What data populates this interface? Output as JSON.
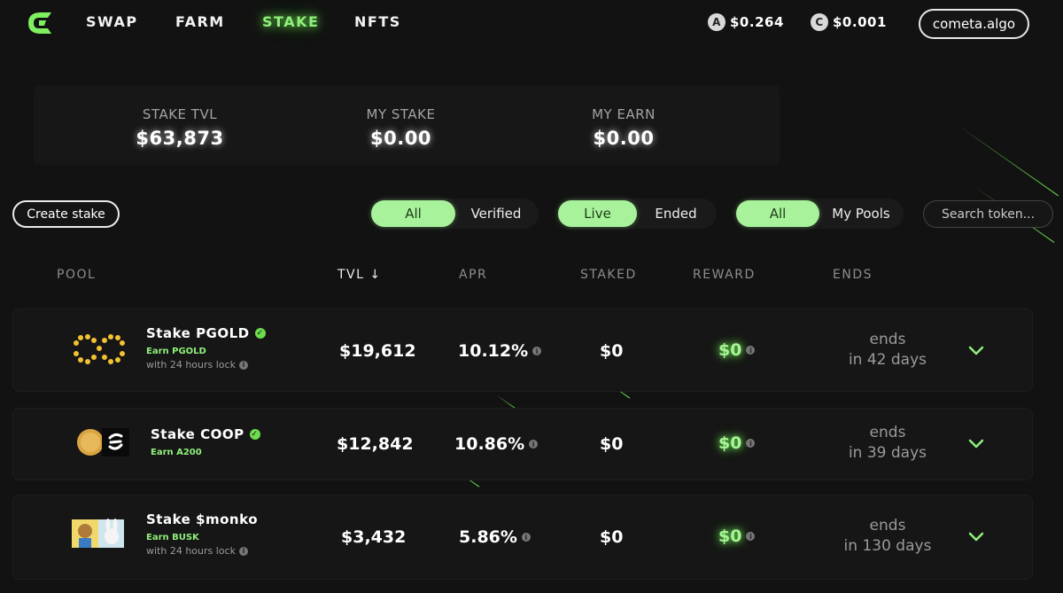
{
  "nav": {
    "links": [
      "SWAP",
      "FARM",
      "STAKE",
      "NFTS"
    ],
    "active": "STAKE",
    "prices": [
      {
        "icon": "algo-coin-icon",
        "value": "$0.264"
      },
      {
        "icon": "cometa-coin-icon",
        "value": "$0.001"
      }
    ],
    "wallet": "cometa.algo"
  },
  "stats": [
    {
      "label": "STAKE TVL",
      "value": "$63,873"
    },
    {
      "label": "MY STAKE",
      "value": "$0.00"
    },
    {
      "label": "MY EARN",
      "value": "$0.00"
    }
  ],
  "filters": {
    "create_label": "Create stake",
    "verify": [
      "All",
      "Verified"
    ],
    "status": [
      "Live",
      "Ended"
    ],
    "owner": [
      "All",
      "My Pools"
    ],
    "search_placeholder": "Search token..."
  },
  "table": {
    "headers": [
      "POOL",
      "TVL ↓",
      "APR",
      "STAKED",
      "REWARD",
      "ENDS"
    ],
    "rows": [
      {
        "name": "Stake PGOLD",
        "earn": "Earn PGOLD",
        "lock": "with 24 hours lock",
        "tvl": "$19,612",
        "apr": "10.12%",
        "staked": "$0",
        "reward": "$0",
        "ends1": "ends",
        "ends2": "in 42 days"
      },
      {
        "name": "Stake COOP",
        "earn": "Earn A200",
        "lock": "",
        "tvl": "$12,842",
        "apr": "10.86%",
        "staked": "$0",
        "reward": "$0",
        "ends1": "ends",
        "ends2": "in 39 days"
      },
      {
        "name": "Stake $monko",
        "earn": "Earn BUSK",
        "lock": "with 24 hours lock",
        "tvl": "$3,432",
        "apr": "5.86%",
        "staked": "$0",
        "reward": "$0",
        "ends1": "ends",
        "ends2": "in 130 days"
      }
    ]
  },
  "colors": {
    "accent": "#8ff07a",
    "background": "#121212"
  }
}
